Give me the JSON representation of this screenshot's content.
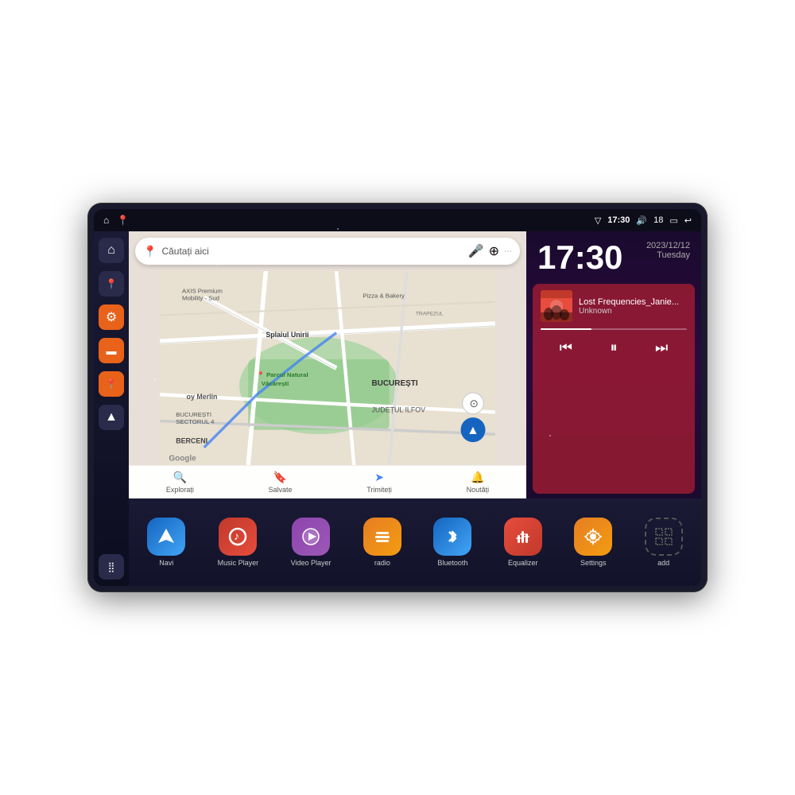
{
  "device": {
    "status_bar": {
      "wifi_icon": "▼",
      "time": "17:30",
      "volume_icon": "🔊",
      "battery_level": "18",
      "battery_icon": "🔋",
      "back_icon": "↩"
    },
    "sidebar": {
      "buttons": [
        {
          "id": "home",
          "icon": "⌂",
          "style": "dark"
        },
        {
          "id": "maps",
          "icon": "📍",
          "style": "dark"
        },
        {
          "id": "settings",
          "icon": "⚙",
          "style": "orange"
        },
        {
          "id": "files",
          "icon": "📁",
          "style": "orange"
        },
        {
          "id": "navigation",
          "icon": "📍",
          "style": "orange"
        },
        {
          "id": "arrow",
          "icon": "▲",
          "style": "dark"
        },
        {
          "id": "grid",
          "icon": "⋮⋮",
          "style": "dark",
          "bottom": true
        }
      ]
    },
    "map": {
      "search_placeholder": "Căutați aici",
      "labels": [
        "AXIS Premium Mobility - Sud",
        "Pizza & Bakery",
        "Parcul Natural Văcărești",
        "TRAPEZUL",
        "BUCUREȘTI",
        "BUCUREȘTI SECTORUL 4",
        "JUDEȚUL ILFOV",
        "BERCENI",
        "Splaiul Unirii",
        "oy Merlin"
      ],
      "bottom_nav": [
        {
          "icon": "🔍",
          "label": "Explorați"
        },
        {
          "icon": "🔖",
          "label": "Salvate"
        },
        {
          "icon": "➤",
          "label": "Trimiteți"
        },
        {
          "icon": "🔔",
          "label": "Noutăți"
        }
      ]
    },
    "clock": {
      "time": "17:30",
      "date": "2023/12/12",
      "day": "Tuesday"
    },
    "music": {
      "title": "Lost Frequencies_Janie...",
      "artist": "Unknown",
      "controls": {
        "prev": "⏮",
        "pause": "⏸",
        "next": "⏭"
      }
    },
    "apps": [
      {
        "id": "navi",
        "icon": "▲",
        "label": "Navi",
        "style": "navi"
      },
      {
        "id": "music",
        "icon": "🎵",
        "label": "Music Player",
        "style": "music"
      },
      {
        "id": "video",
        "icon": "▶",
        "label": "Video Player",
        "style": "video"
      },
      {
        "id": "radio",
        "icon": "📻",
        "label": "radio",
        "style": "radio"
      },
      {
        "id": "bluetooth",
        "icon": "⚡",
        "label": "Bluetooth",
        "style": "bt"
      },
      {
        "id": "equalizer",
        "icon": "🎚",
        "label": "Equalizer",
        "style": "eq"
      },
      {
        "id": "settings",
        "icon": "⚙",
        "label": "Settings",
        "style": "settings"
      },
      {
        "id": "add",
        "icon": "+",
        "label": "add",
        "style": "add"
      }
    ]
  }
}
